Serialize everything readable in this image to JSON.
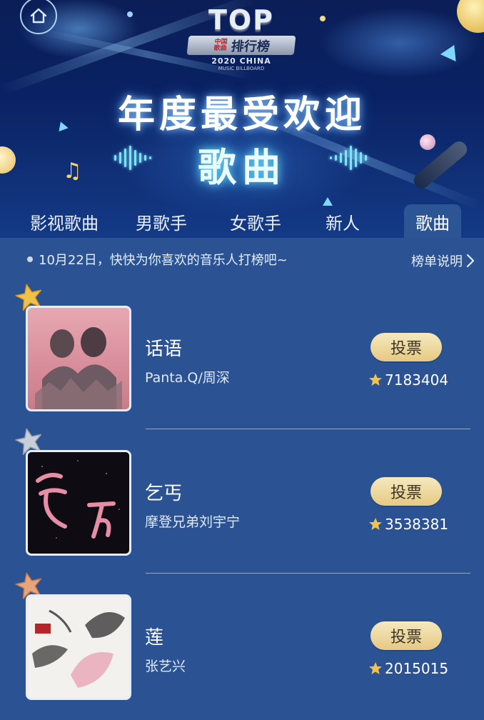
{
  "hero": {
    "logo_top": "TOP",
    "logo_name_small": "中国歌曲",
    "logo_name": "排行榜",
    "logo_year": "2020 CHINA",
    "logo_sub": "MUSIC BILLBOARD",
    "title": "年度最受欢迎",
    "subtitle": "歌曲"
  },
  "tabs": [
    {
      "label": "影视歌曲",
      "active": false
    },
    {
      "label": "男歌手",
      "active": false
    },
    {
      "label": "女歌手",
      "active": false
    },
    {
      "label": "新人",
      "active": false
    },
    {
      "label": "歌曲",
      "active": true
    }
  ],
  "notice": {
    "text": "10月22日，快快为你喜欢的音乐人打榜吧~",
    "rules_label": "榜单说明"
  },
  "songs": [
    {
      "title": "话语",
      "artist": "Panta.Q/周深",
      "votes": "7183404",
      "vote_label": "投票",
      "badge_color": "#f0c24a"
    },
    {
      "title": "乞丐",
      "artist": "摩登兄弟刘宇宁",
      "votes": "3538381",
      "vote_label": "投票",
      "badge_color": "#c9cfd8"
    },
    {
      "title": "莲",
      "artist": "张艺兴",
      "votes": "2015015",
      "vote_label": "投票",
      "badge_color": "#e8a47b"
    }
  ],
  "icons": {
    "home": "home-icon",
    "chevron": "chevron-right-icon",
    "star": "star-icon"
  }
}
